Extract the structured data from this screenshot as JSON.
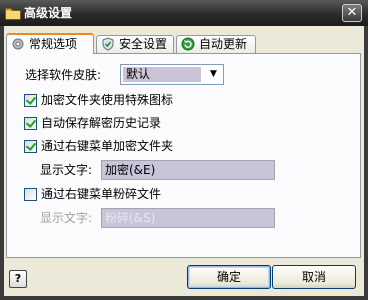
{
  "window": {
    "title": "高级设置",
    "close_glyph": "✕"
  },
  "tabs": [
    {
      "label": "常规选项",
      "icon": "gear-icon",
      "active": true
    },
    {
      "label": "安全设置",
      "icon": "shield-icon",
      "active": false
    },
    {
      "label": "自动更新",
      "icon": "update-icon",
      "active": false
    }
  ],
  "skin": {
    "label": "选择软件皮肤:",
    "value": "默认"
  },
  "options": {
    "special_icon": {
      "label": "加密文件夹使用特殊图标",
      "checked": true
    },
    "autosave_history": {
      "label": "自动保存解密历史记录",
      "checked": true
    },
    "context_encrypt": {
      "label": "通过右键菜单加密文件夹",
      "checked": true
    },
    "encrypt_display_label": "显示文字:",
    "encrypt_display_value": "加密(&E)",
    "context_shred": {
      "label": "通过右键菜单粉碎文件",
      "checked": false
    },
    "shred_display_label": "显示文字:",
    "shred_display_value": "粉碎(&S)"
  },
  "buttons": {
    "help": "?",
    "ok": "确定",
    "cancel": "取消"
  }
}
